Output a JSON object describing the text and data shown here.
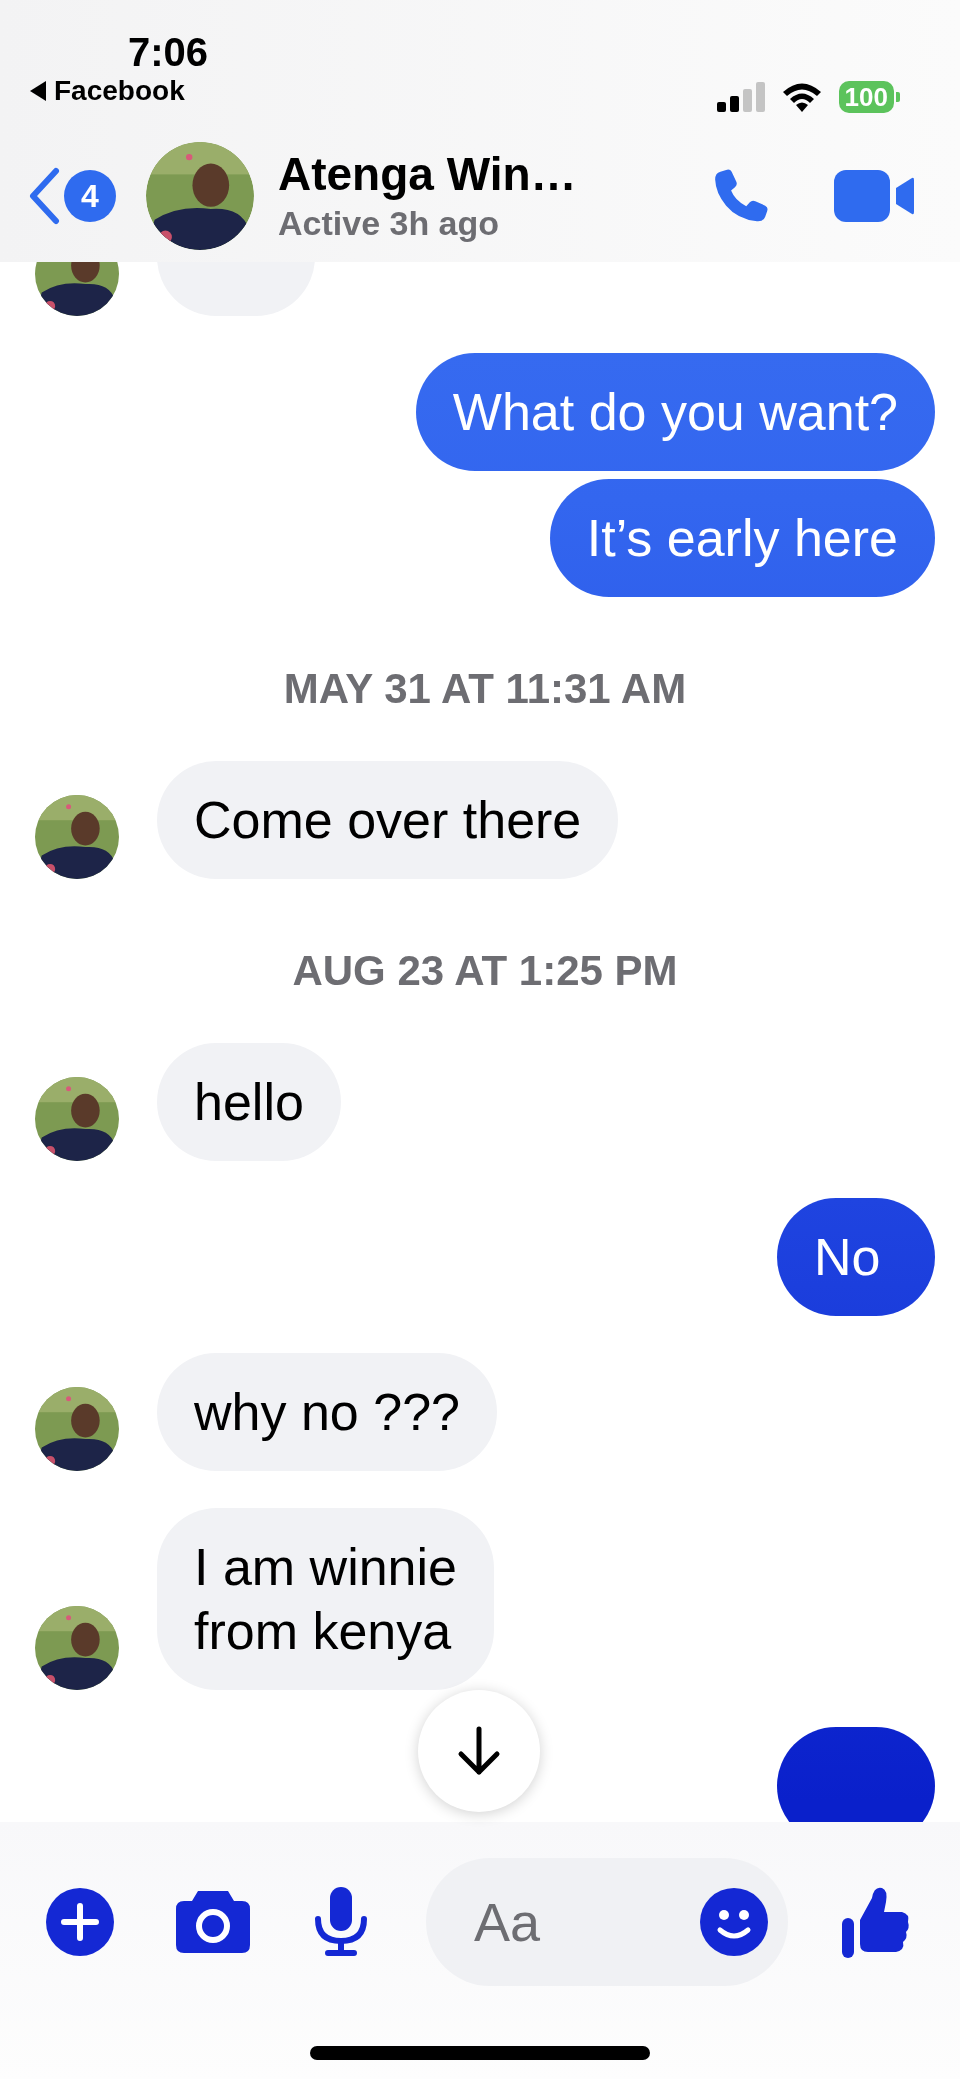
{
  "status_bar": {
    "time": "7:06",
    "back_app": "Facebook",
    "battery": "100"
  },
  "header": {
    "unread_count": "4",
    "name": "Atenga Win…",
    "status": "Active 3h ago"
  },
  "messages": [
    {
      "kind": "incoming",
      "avatar": true
    },
    {
      "kind": "outgoing",
      "lines": [
        "What do you want?"
      ]
    },
    {
      "kind": "outgoing",
      "lines": [
        "It’s early here"
      ]
    },
    {
      "kind": "timestamp",
      "lines": [
        "MAY 31 AT 11:31 AM"
      ]
    },
    {
      "kind": "incoming",
      "lines": [
        "Come over there"
      ],
      "avatar": true
    },
    {
      "kind": "timestamp",
      "lines": [
        "AUG 23 AT 1:25 PM"
      ]
    },
    {
      "kind": "incoming",
      "lines": [
        "hello"
      ],
      "avatar": true
    },
    {
      "kind": "outgoing",
      "lines": [
        "No"
      ]
    },
    {
      "kind": "incoming",
      "lines": [
        "why no ???"
      ],
      "avatar": true
    },
    {
      "kind": "incoming",
      "lines": [
        "I am winnie",
        "from kenya"
      ],
      "avatar": true
    },
    {
      "kind": "outgoing"
    }
  ],
  "composer": {
    "placeholder": "Aa"
  }
}
